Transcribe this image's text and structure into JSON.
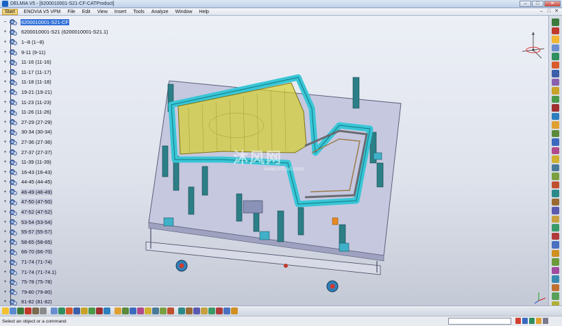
{
  "window": {
    "title": "DELMIA V5 - [6200010001-S21-CF-CATProduct]",
    "controls": [
      "–",
      "□",
      "✕"
    ]
  },
  "menu": {
    "items": [
      "Start",
      "ENOVIA V5 VPM",
      "File",
      "Edit",
      "View",
      "Insert",
      "Tools",
      "Analyze",
      "Window",
      "Help"
    ],
    "mdi_controls": [
      "–",
      "□",
      "✕"
    ]
  },
  "tree": {
    "root": "6200010001-S21-CF",
    "nodes": [
      "6200010001-S21 (6200010001-S21.1)",
      "1--8 (1--8)",
      "9-11 (9-11)",
      "11-16 (11-16)",
      "11-17 (11-17)",
      "11-18 (11-18)",
      "19-21 (19-21)",
      "11-23 (11-23)",
      "11-26 (11-26)",
      "27-29 (27-29)",
      "30-34 (30-34)",
      "27-36 (27-36)",
      "27-37 (27-37)",
      "11-39 (11-39)",
      "16-43 (16-43)",
      "44-45 (44-45)",
      "46-49 (46-49)",
      "47-50 (47-50)",
      "47-52 (47-52)",
      "53-54 (53-54)",
      "55-57 (55-57)",
      "58-65 (58-65)",
      "66-70 (66-70)",
      "71-74 (71-74)",
      "71-74 (71-74.1)",
      "75-78 (75-78)",
      "79-80 (79-80)",
      "81-82 (81-82)"
    ],
    "selected_highlight_from_index": 16
  },
  "watermark": {
    "text": "沐风网",
    "sub": "www.mfcad.com"
  },
  "icons": {
    "compass": "compass-icon",
    "axis": "axis-triad-icon",
    "right_toolbar_colors": [
      "#3a7a3a",
      "#c0392b",
      "#f2b632",
      "#6a8fcf",
      "#2f8f5f",
      "#d95a2b",
      "#3b5fa8",
      "#8a5fb0",
      "#c9a227",
      "#4a9a4a",
      "#a03030",
      "#2b7fbf",
      "#e0a030",
      "#5a8a3a",
      "#3a6ac0",
      "#b04a8a",
      "#d0b030",
      "#4a7a9a",
      "#7aa040",
      "#c05030",
      "#2a8a8a",
      "#9a6a30",
      "#5a5ab0",
      "#c8a040",
      "#3a9a6a",
      "#b03a3a",
      "#4a70c0",
      "#d09020",
      "#6a9a3a",
      "#a04aa0",
      "#3a8ab0",
      "#c07030",
      "#5aa05a",
      "#b0b030",
      "#4a4a9a",
      "#d06060"
    ],
    "bottom_toolbar_colors": [
      "#f2c230",
      "#5a8ad0",
      "#3a7a3a",
      "#c0392b",
      "#7a6a50",
      "#8a8a8a",
      "#6a8fcf",
      "#2f8f5f",
      "#d95a2b",
      "#3b5fa8",
      "#c9a227",
      "#4a9a4a",
      "#a03030",
      "#2b7fbf",
      "#e0a030",
      "#5a8a3a",
      "#3a6ac0",
      "#b04a8a",
      "#d0b030",
      "#4a7a9a",
      "#7aa040",
      "#c05030",
      "#2a8a8a",
      "#9a6a30",
      "#5a5ab0",
      "#c8a040",
      "#3a9a6a",
      "#b03a3a",
      "#4a70c0",
      "#d09020"
    ]
  },
  "status": {
    "text": "Select an object or a command"
  }
}
